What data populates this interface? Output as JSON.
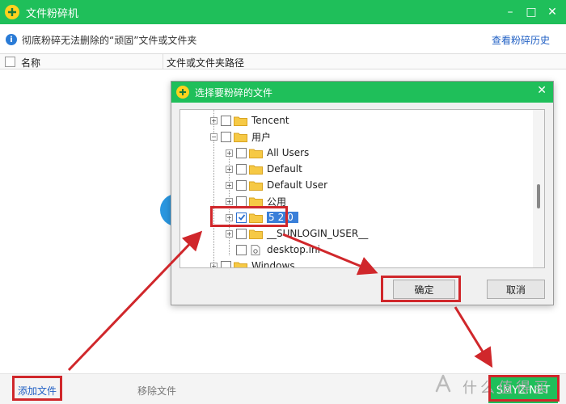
{
  "window": {
    "title": "文件粉碎机",
    "minimize": "–",
    "maximize": "□",
    "close": "✕"
  },
  "infobar": {
    "text": "彻底粉碎无法删除的“顽固”文件或文件夹",
    "history_link": "查看粉碎历史"
  },
  "list": {
    "col_name": "名称",
    "col_path": "文件或文件夹路径"
  },
  "footer": {
    "add_file": "添加文件",
    "remove_file": "移除文件",
    "start": "SMYZ.NET",
    "watermark": "什么值得买"
  },
  "dialog": {
    "title": "选择要粉碎的文件",
    "close": "✕",
    "ok": "确定",
    "cancel": "取消",
    "tree": [
      {
        "label": "Tencent",
        "level": 0,
        "checked": false,
        "expander": true,
        "icon": "folder"
      },
      {
        "label": "用户",
        "level": 0,
        "checked": false,
        "expander": true,
        "expanded": true,
        "icon": "folder"
      },
      {
        "label": "All Users",
        "level": 1,
        "checked": false,
        "expander": true,
        "icon": "folder"
      },
      {
        "label": "Default",
        "level": 1,
        "checked": false,
        "expander": true,
        "icon": "folder"
      },
      {
        "label": "Default User",
        "level": 1,
        "checked": false,
        "expander": true,
        "icon": "folder"
      },
      {
        "label": "公用",
        "level": 1,
        "checked": false,
        "expander": true,
        "icon": "folder"
      },
      {
        "label": "520",
        "level": 1,
        "checked": true,
        "expander": true,
        "selected": true,
        "icon": "folder"
      },
      {
        "label": "__SUNLOGIN_USER__",
        "level": 1,
        "checked": false,
        "expander": true,
        "icon": "folder"
      },
      {
        "label": "desktop.ini",
        "level": 1,
        "checked": false,
        "expander": false,
        "icon": "ini-file"
      },
      {
        "label": "Windows",
        "level": 0,
        "checked": false,
        "expander": true,
        "icon": "folder"
      }
    ]
  },
  "colors": {
    "accent": "#1fbf5a",
    "annotation": "#d0272b",
    "link": "#2160c4",
    "selection": "#3a7fd9"
  }
}
